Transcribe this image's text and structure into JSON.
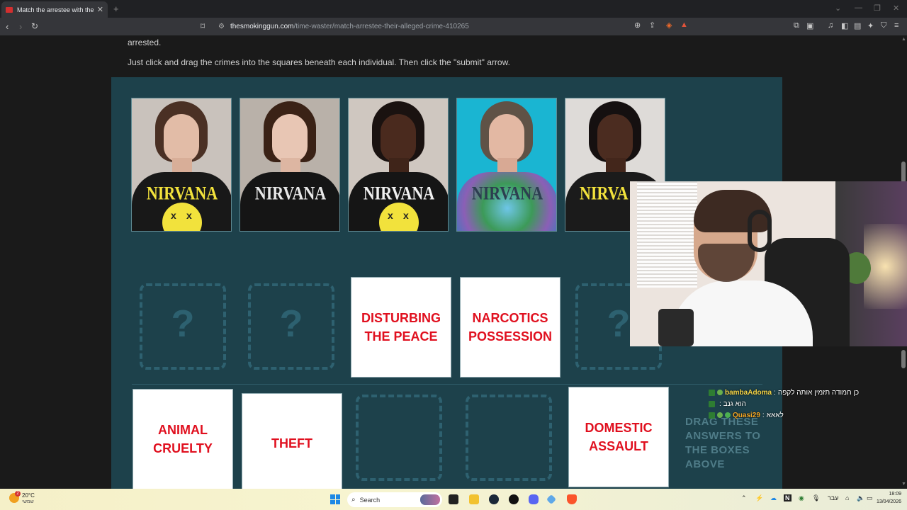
{
  "browser": {
    "tab_title": "Match the arrestee with their alleg",
    "tab_close": "✕",
    "new_tab": "+",
    "url_host": "thesmokinggun.com",
    "url_path": "/time-waster/match-arrestee-their-alleged-crime-410265"
  },
  "page": {
    "intro_line1": "arrested.",
    "intro_line2": "Just click and drag the crimes into the squares beneath each individual. Then click the \"submit\" arrow."
  },
  "game": {
    "mugshots": [
      {
        "shirt_text": "NIRVANA",
        "name": "mugshot-1"
      },
      {
        "shirt_text": "NIRVANA",
        "name": "mugshot-2"
      },
      {
        "shirt_text": "NIRVANA",
        "name": "mugshot-3"
      },
      {
        "shirt_text": "NIRVANA",
        "name": "mugshot-4"
      },
      {
        "shirt_text": "NIRVA",
        "name": "mugshot-5"
      }
    ],
    "placeholder": "?",
    "placed_crimes": [
      {
        "label": "DISTURBING THE PEACE"
      },
      {
        "label": "NARCOTICS POSSESSION"
      }
    ],
    "answer_cards": [
      {
        "label": "ANIMAL CRUELTY"
      },
      {
        "label": "THEFT"
      },
      {
        "label": "DOMESTIC ASSAULT"
      }
    ],
    "drag_hint": "DRAG THESE ANSWERS TO THE BOXES ABOVE"
  },
  "chat": [
    {
      "user": "bambaAdoma",
      "message": "כן חמודה תזמין אותה לקפה",
      "user_color": "#f5d547"
    },
    {
      "user": "",
      "message": "הוא גנב",
      "user_color": "#e03030"
    },
    {
      "user": "Quasi29",
      "message": "לאאא",
      "user_color": "#f5a623"
    }
  ],
  "taskbar": {
    "weather_temp": "20°C",
    "weather_desc": "שמשי",
    "weather_badge": "2",
    "search_label": "Search",
    "lang": "עבר",
    "time": "18:09",
    "date": "13/04/2026"
  }
}
